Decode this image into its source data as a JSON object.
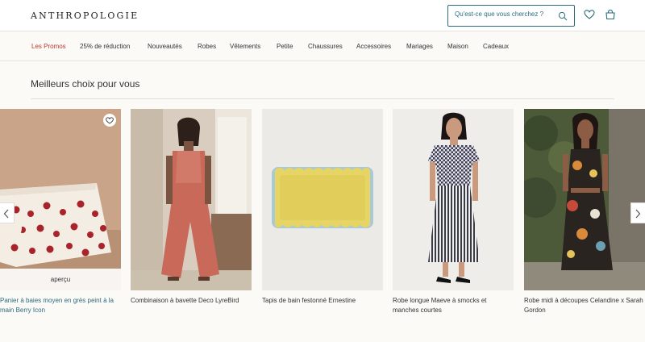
{
  "header": {
    "logo": "ANTHROPOLOGIE",
    "search_placeholder": "Qu'est-ce que vous cherchez ?",
    "search_icon": "search-icon",
    "wishlist_icon": "heart-icon",
    "bag_icon": "shopping-bag-icon"
  },
  "nav": {
    "items": [
      {
        "label": "Les Promos",
        "color": "#c2352b"
      },
      {
        "label": "25% de réduction"
      },
      {
        "label": "Nouveautés"
      },
      {
        "label": "Robes"
      },
      {
        "label": "Vêtements"
      },
      {
        "label": "Petite"
      },
      {
        "label": "Chaussures"
      },
      {
        "label": "Accessoires"
      },
      {
        "label": "Mariages"
      },
      {
        "label": "Maison"
      },
      {
        "label": "Cadeaux"
      }
    ]
  },
  "section": {
    "title": "Meilleurs choix pour vous"
  },
  "products": [
    {
      "name": "Panier à baies moyen en grès peint à la main Berry Icon",
      "overlay": "aperçu"
    },
    {
      "name": "Combinaison à bavette Deco LyreBird"
    },
    {
      "name": "Tapis de bain festonné Ernestine"
    },
    {
      "name": "Robe longue Maeve à smocks et manches courtes"
    },
    {
      "name": "Robe midi à découpes Celandine x Sarah Gordon"
    }
  ],
  "carousel": {
    "prev_icon": "chevron-left-icon",
    "next_icon": "chevron-right-icon"
  },
  "colors": {
    "accent": "#2b6b7e",
    "promo": "#c2352b",
    "background": "#fbfaf7"
  }
}
